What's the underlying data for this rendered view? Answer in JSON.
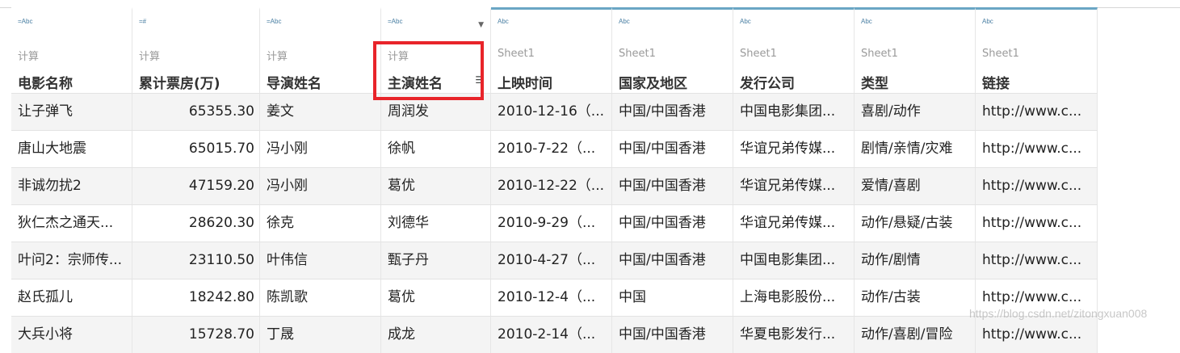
{
  "columns": [
    {
      "type": "=Abc",
      "source": "计算",
      "name": "电影名称",
      "kind": "calc"
    },
    {
      "type": "=#",
      "source": "计算",
      "name": "累计票房(万)",
      "kind": "calc"
    },
    {
      "type": "=Abc",
      "source": "计算",
      "name": "导演姓名",
      "kind": "calc"
    },
    {
      "type": "=Abc",
      "source": "计算",
      "name": "主演姓名",
      "kind": "calc"
    },
    {
      "type": "Abc",
      "source": "Sheet1",
      "name": "上映时间",
      "kind": "sheet"
    },
    {
      "type": "Abc",
      "source": "Sheet1",
      "name": "国家及地区",
      "kind": "sheet"
    },
    {
      "type": "Abc",
      "source": "Sheet1",
      "name": "发行公司",
      "kind": "sheet"
    },
    {
      "type": "Abc",
      "source": "Sheet1",
      "name": "类型",
      "kind": "sheet"
    },
    {
      "type": "Abc",
      "source": "Sheet1",
      "name": "链接",
      "kind": "sheet"
    }
  ],
  "rows": [
    [
      "让子弹飞",
      "65355.30",
      "姜文",
      "周润发",
      "2010-12-16（...",
      "中国/中国香港",
      "中国电影集团...",
      "喜剧/动作",
      "http://www.c..."
    ],
    [
      "唐山大地震",
      "65015.70",
      "冯小刚",
      "徐帆",
      "2010-7-22（...",
      "中国/中国香港",
      "华谊兄弟传媒...",
      "剧情/亲情/灾难",
      "http://www.c..."
    ],
    [
      "非诚勿扰2",
      "47159.20",
      "冯小刚",
      "葛优",
      "2010-12-22（...",
      "中国/中国香港",
      "华谊兄弟传媒...",
      "爱情/喜剧",
      "http://www.c..."
    ],
    [
      "狄仁杰之通天...",
      "28620.30",
      "徐克",
      "刘德华",
      "2010-9-29（...",
      "中国/中国香港",
      "华谊兄弟传媒...",
      "动作/悬疑/古装",
      "http://www.c..."
    ],
    [
      "叶问2：宗师传...",
      "23110.50",
      "叶伟信",
      "甄子丹",
      "2010-4-27（...",
      "中国/中国香港",
      "中国电影集团...",
      "动作/剧情",
      "http://www.c..."
    ],
    [
      "赵氏孤儿",
      "18242.80",
      "陈凯歌",
      "葛优",
      "2010-12-4（...",
      "中国",
      "上海电影股份...",
      "动作/古装",
      "http://www.c..."
    ],
    [
      "大兵小将",
      "15728.70",
      "丁晟",
      "成龙",
      "2010-2-14（...",
      "中国/中国香港",
      "华夏电影发行...",
      "动作/喜剧/冒险",
      "http://www.c..."
    ]
  ],
  "icons": {
    "dropdown": "chevron-down-icon",
    "sort": "sort-icon"
  },
  "colors": {
    "highlight_box": "#e8242a",
    "sheet_accent": "#6aa6c4"
  },
  "watermark": "https://blog.csdn.net/zitongxuan008"
}
